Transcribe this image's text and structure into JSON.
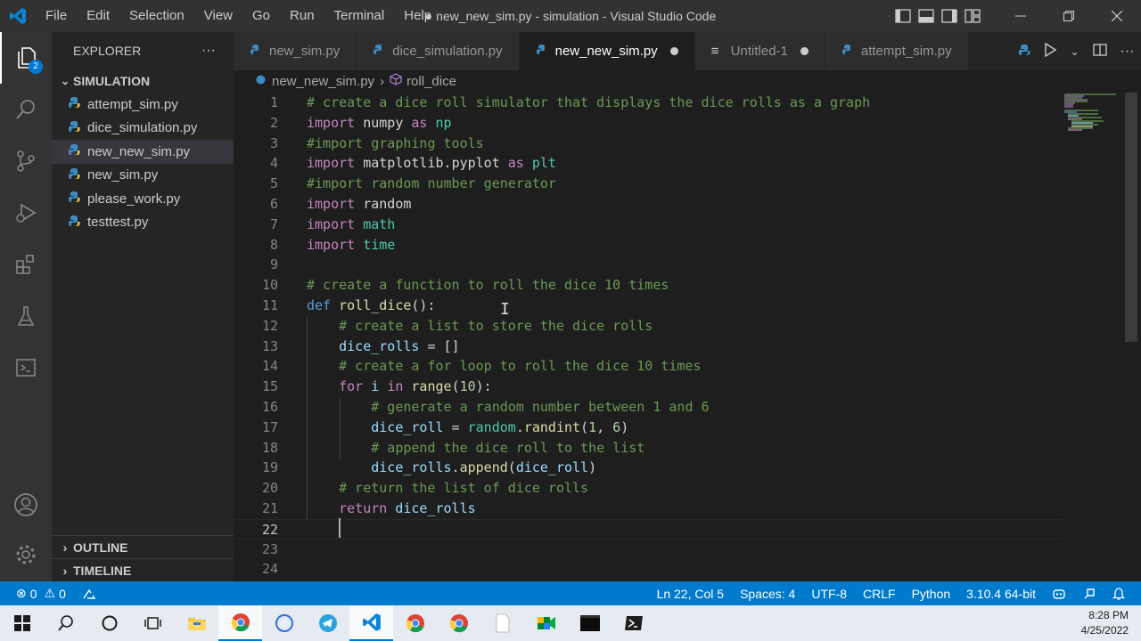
{
  "menu": [
    "File",
    "Edit",
    "Selection",
    "View",
    "Go",
    "Run",
    "Terminal",
    "Help"
  ],
  "window_title": "● new_new_sim.py - simulation - Visual Studio Code",
  "explorer": {
    "header": "EXPLORER",
    "more": "···",
    "folder": "SIMULATION",
    "files": [
      "attempt_sim.py",
      "dice_simulation.py",
      "new_new_sim.py",
      "new_sim.py",
      "please_work.py",
      "testtest.py"
    ],
    "active_file_index": 2,
    "outline": "OUTLINE",
    "timeline": "TIMELINE",
    "badge": "2"
  },
  "tabs": [
    {
      "label": "new_sim.py",
      "active": false,
      "dirty": false
    },
    {
      "label": "dice_simulation.py",
      "active": false,
      "dirty": false
    },
    {
      "label": "new_new_sim.py",
      "active": true,
      "dirty": true
    },
    {
      "label": "Untitled-1",
      "active": false,
      "dirty": true
    },
    {
      "label": "attempt_sim.py",
      "active": false,
      "dirty": false
    }
  ],
  "breadcrumb": {
    "file": "new_new_sim.py",
    "symbol": "roll_dice"
  },
  "code_lines": [
    {
      "n": "1",
      "t": "# create a dice roll simulator that displays the dice rolls as a graph"
    },
    {
      "n": "2",
      "t": "import numpy as np"
    },
    {
      "n": "3",
      "t": "#import graphing tools"
    },
    {
      "n": "4",
      "t": "import matplotlib.pyplot as plt"
    },
    {
      "n": "5",
      "t": "#import random number generator"
    },
    {
      "n": "6",
      "t": "import random"
    },
    {
      "n": "7",
      "t": "import math"
    },
    {
      "n": "8",
      "t": "import time"
    },
    {
      "n": "9",
      "t": ""
    },
    {
      "n": "10",
      "t": "# create a function to roll the dice 10 times"
    },
    {
      "n": "11",
      "t": "def roll_dice():"
    },
    {
      "n": "12",
      "t": "    # create a list to store the dice rolls"
    },
    {
      "n": "13",
      "t": "    dice_rolls = []"
    },
    {
      "n": "14",
      "t": "    # create a for loop to roll the dice 10 times"
    },
    {
      "n": "15",
      "t": "    for i in range(10):"
    },
    {
      "n": "16",
      "t": "        # generate a random number between 1 and 6"
    },
    {
      "n": "17",
      "t": "        dice_roll = random.randint(1, 6)"
    },
    {
      "n": "18",
      "t": "        # append the dice roll to the list"
    },
    {
      "n": "19",
      "t": "        dice_rolls.append(dice_roll)"
    },
    {
      "n": "20",
      "t": "    # return the list of dice rolls"
    },
    {
      "n": "21",
      "t": "    return dice_rolls"
    },
    {
      "n": "22",
      "t": "    "
    },
    {
      "n": "23",
      "t": ""
    },
    {
      "n": "24",
      "t": ""
    }
  ],
  "current_line": "22",
  "status": {
    "errors": "0",
    "warnings": "0",
    "position": "Ln 22, Col 5",
    "spaces": "Spaces: 4",
    "encoding": "UTF-8",
    "eol": "CRLF",
    "language": "Python",
    "interpreter": "3.10.4 64-bit"
  },
  "clock": {
    "time": "8:28 PM",
    "date": "4/25/2022"
  },
  "colors": {
    "accent": "#007acc",
    "tab_active": "#1e1e1e",
    "comment": "#6a9955",
    "keyword": "#c586c0"
  }
}
